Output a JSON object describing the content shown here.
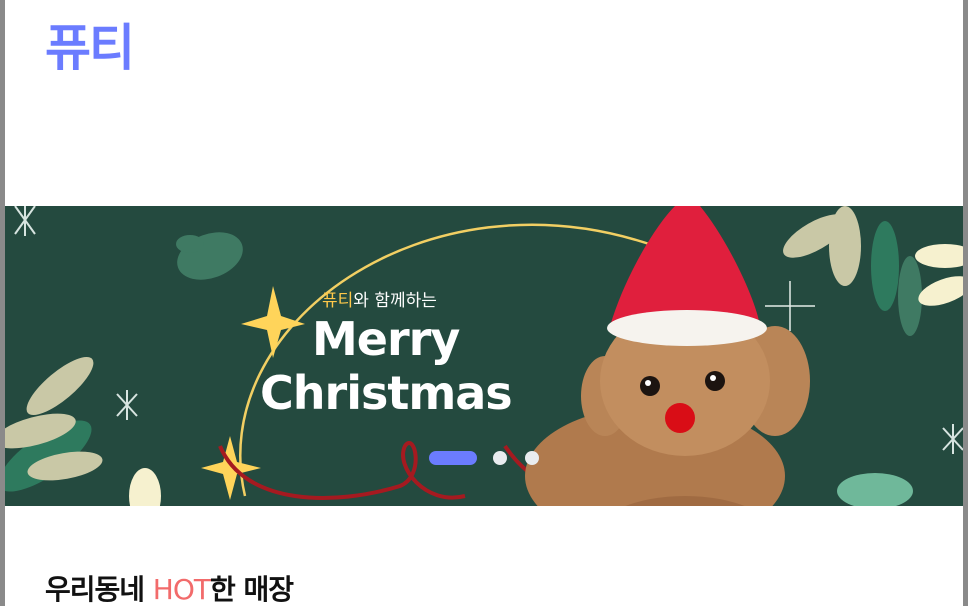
{
  "header": {
    "logo": "퓨티"
  },
  "banner": {
    "subtitle_brand": "퓨티",
    "subtitle_rest": "와 함께하는",
    "title_line1": "Merry",
    "title_line2": "Christmas",
    "slide_count": 3,
    "active_slide": 1,
    "colors": {
      "background": "#244a3f",
      "accent": "#6b7cff",
      "brand_yellow": "#ffc94a",
      "hat_red": "#e01f3d"
    }
  },
  "section": {
    "title_prefix": "우리동네 ",
    "title_hot": "HOT",
    "title_suffix": "한 매장"
  }
}
